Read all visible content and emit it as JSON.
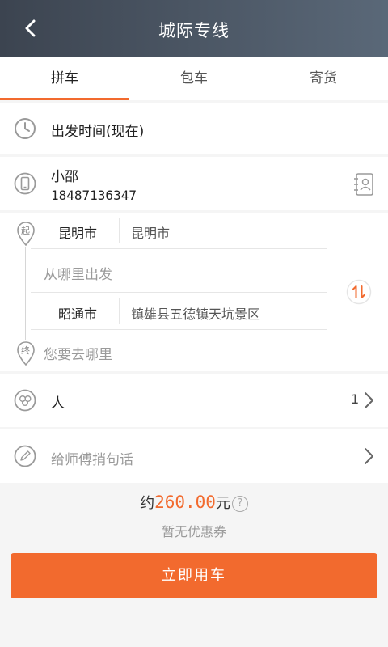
{
  "header": {
    "title": "城际专线",
    "back_icon": "chevron-left-icon"
  },
  "tabs": [
    {
      "label": "拼车",
      "active": true
    },
    {
      "label": "包车",
      "active": false
    },
    {
      "label": "寄货",
      "active": false
    }
  ],
  "departure_time": {
    "label": "出发时间(现在)",
    "icon": "clock-icon"
  },
  "contact": {
    "name": "小邵",
    "phone": "18487136347",
    "icon": "phone-icon",
    "contacts_icon": "contact-book-icon"
  },
  "route": {
    "start_marker": "起",
    "end_marker": "终",
    "from_city": "昆明市",
    "from_area": "昆明市",
    "from_placeholder": "从哪里出发",
    "to_city": "昭通市",
    "to_area": "镇雄县五德镇天坑景区",
    "to_placeholder": "您要去哪里",
    "swap_icon": "swap-icon"
  },
  "passengers": {
    "label": "人",
    "count": "1",
    "icon": "people-icon"
  },
  "message": {
    "placeholder": "给师傅捎句话",
    "icon": "pencil-icon"
  },
  "price": {
    "prefix": "约",
    "amount": "260.00",
    "unit": "元",
    "help": "?"
  },
  "coupon": "暂无优惠券",
  "submit_label": "立即用车",
  "colors": {
    "accent": "#f26a2e",
    "header_bg": "#4a5564",
    "background": "#f5f5f5"
  }
}
